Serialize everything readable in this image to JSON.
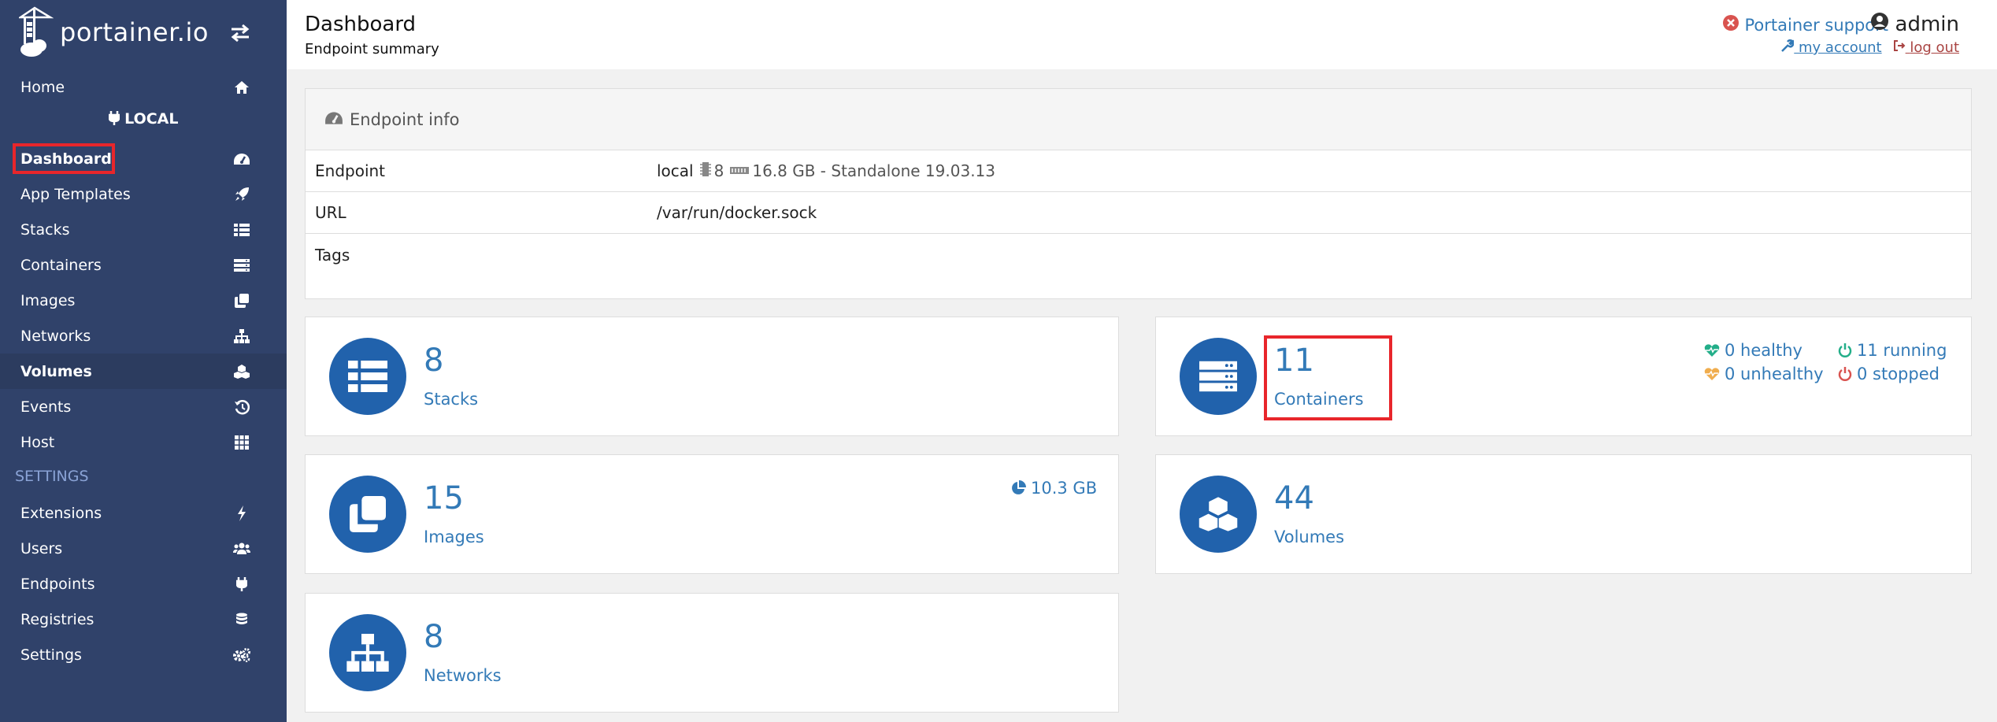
{
  "app": {
    "logo_text": "portainer.io"
  },
  "sidebar": {
    "home": "Home",
    "endpoint_name": "LOCAL",
    "items": [
      {
        "label": "Dashboard",
        "icon": "tachometer-icon"
      },
      {
        "label": "App Templates",
        "icon": "rocket-icon"
      },
      {
        "label": "Stacks",
        "icon": "th-list-icon"
      },
      {
        "label": "Containers",
        "icon": "server-icon"
      },
      {
        "label": "Images",
        "icon": "clone-icon"
      },
      {
        "label": "Networks",
        "icon": "sitemap-icon"
      },
      {
        "label": "Volumes",
        "icon": "cubes-icon"
      },
      {
        "label": "Events",
        "icon": "history-icon"
      },
      {
        "label": "Host",
        "icon": "th-icon"
      }
    ],
    "settings_header": "SETTINGS",
    "settings_items": [
      {
        "label": "Extensions",
        "icon": "bolt-icon"
      },
      {
        "label": "Users",
        "icon": "users-icon"
      },
      {
        "label": "Endpoints",
        "icon": "plug-icon"
      },
      {
        "label": "Registries",
        "icon": "database-icon"
      },
      {
        "label": "Settings",
        "icon": "cogs-icon"
      }
    ]
  },
  "header": {
    "title": "Dashboard",
    "subtitle": "Endpoint summary",
    "support": "Portainer support",
    "user": "admin",
    "my_account": "my account",
    "log_out": "log out"
  },
  "endpoint_info": {
    "title": "Endpoint info",
    "rows": [
      {
        "key": "Endpoint",
        "name": "local",
        "cpu": "8",
        "memory": "16.8 GB - Standalone 19.03.13"
      },
      {
        "key": "URL",
        "value": "/var/run/docker.sock"
      },
      {
        "key": "Tags",
        "value": ""
      }
    ]
  },
  "widgets": {
    "stacks": {
      "count": "8",
      "label": "Stacks"
    },
    "containers": {
      "count": "11",
      "label": "Containers",
      "healthy": "0 healthy",
      "unhealthy": "0 unhealthy",
      "running": "11 running",
      "stopped": "0 stopped"
    },
    "images": {
      "count": "15",
      "label": "Images",
      "size": "10.3 GB"
    },
    "volumes": {
      "count": "44",
      "label": "Volumes"
    },
    "networks": {
      "count": "8",
      "label": "Networks"
    }
  },
  "colors": {
    "sidebar_bg": "#30426a",
    "accent": "#337ab7",
    "circle": "#2162ac",
    "healthy": "#23ae89",
    "unhealthy": "#f0ad4e",
    "stopped": "#d9534f",
    "highlight": "#e8262b"
  }
}
